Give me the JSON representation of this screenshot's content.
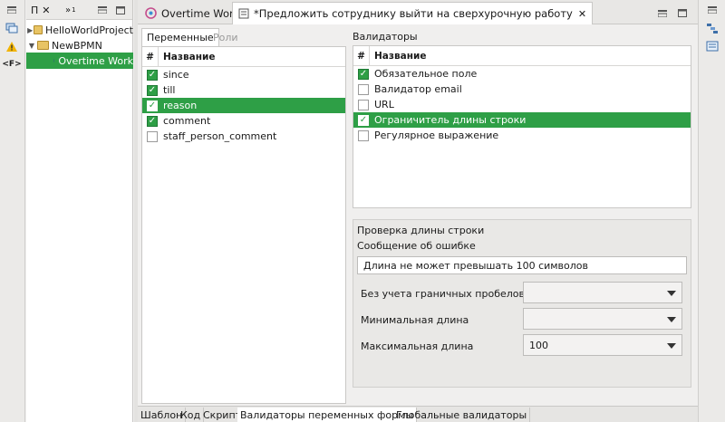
{
  "explorer": {
    "tab_label": "П",
    "close_glyph": "✕",
    "more_glyph": "»",
    "more_count": "1",
    "tree": [
      {
        "label": "HelloWorldProject"
      },
      {
        "label": "NewBPMN"
      },
      {
        "label": "Overtime Work"
      }
    ]
  },
  "editor_tabs": [
    {
      "label": "Overtime Work"
    },
    {
      "label": "*Предложить сотруднику выйти на сверхурочную работу"
    }
  ],
  "variables": {
    "tabs": [
      {
        "label": "Переменные"
      },
      {
        "label": "Роли"
      }
    ],
    "header_hash": "#",
    "header_name": "Название",
    "rows": [
      {
        "label": "since",
        "checked": true
      },
      {
        "label": "till",
        "checked": true
      },
      {
        "label": "reason",
        "checked": true
      },
      {
        "label": "comment",
        "checked": true
      },
      {
        "label": "staff_person_comment",
        "checked": false
      }
    ]
  },
  "validators": {
    "title": "Валидаторы",
    "header_hash": "#",
    "header_name": "Название",
    "rows": [
      {
        "label": "Обязательное поле",
        "checked": true
      },
      {
        "label": "Валидатор email",
        "checked": false
      },
      {
        "label": "URL",
        "checked": false
      },
      {
        "label": "Ограничитель длины строки",
        "checked": true
      },
      {
        "label": "Регулярное выражение",
        "checked": false
      }
    ]
  },
  "settings": {
    "title": "Проверка длины строки",
    "message_label": "Сообщение об ошибке",
    "message_value": "Длина не может превышать 100 символов",
    "trim_label": "Без учета граничных пробелов",
    "trim_value": "",
    "min_label": "Минимальная длина",
    "min_value": "",
    "max_label": "Максимальная длина",
    "max_value": "100"
  },
  "bottom_tabs": [
    {
      "label": "Шаблон"
    },
    {
      "label": "Код"
    },
    {
      "label": "Скрипт"
    },
    {
      "label": "Валидаторы переменных формы"
    },
    {
      "label": "Глобальные валидаторы"
    }
  ],
  "colors": {
    "selection": "#2e9f46",
    "accent_check": "#1c8c3a"
  },
  "icons": {
    "check": "✓",
    "close": "✕"
  }
}
